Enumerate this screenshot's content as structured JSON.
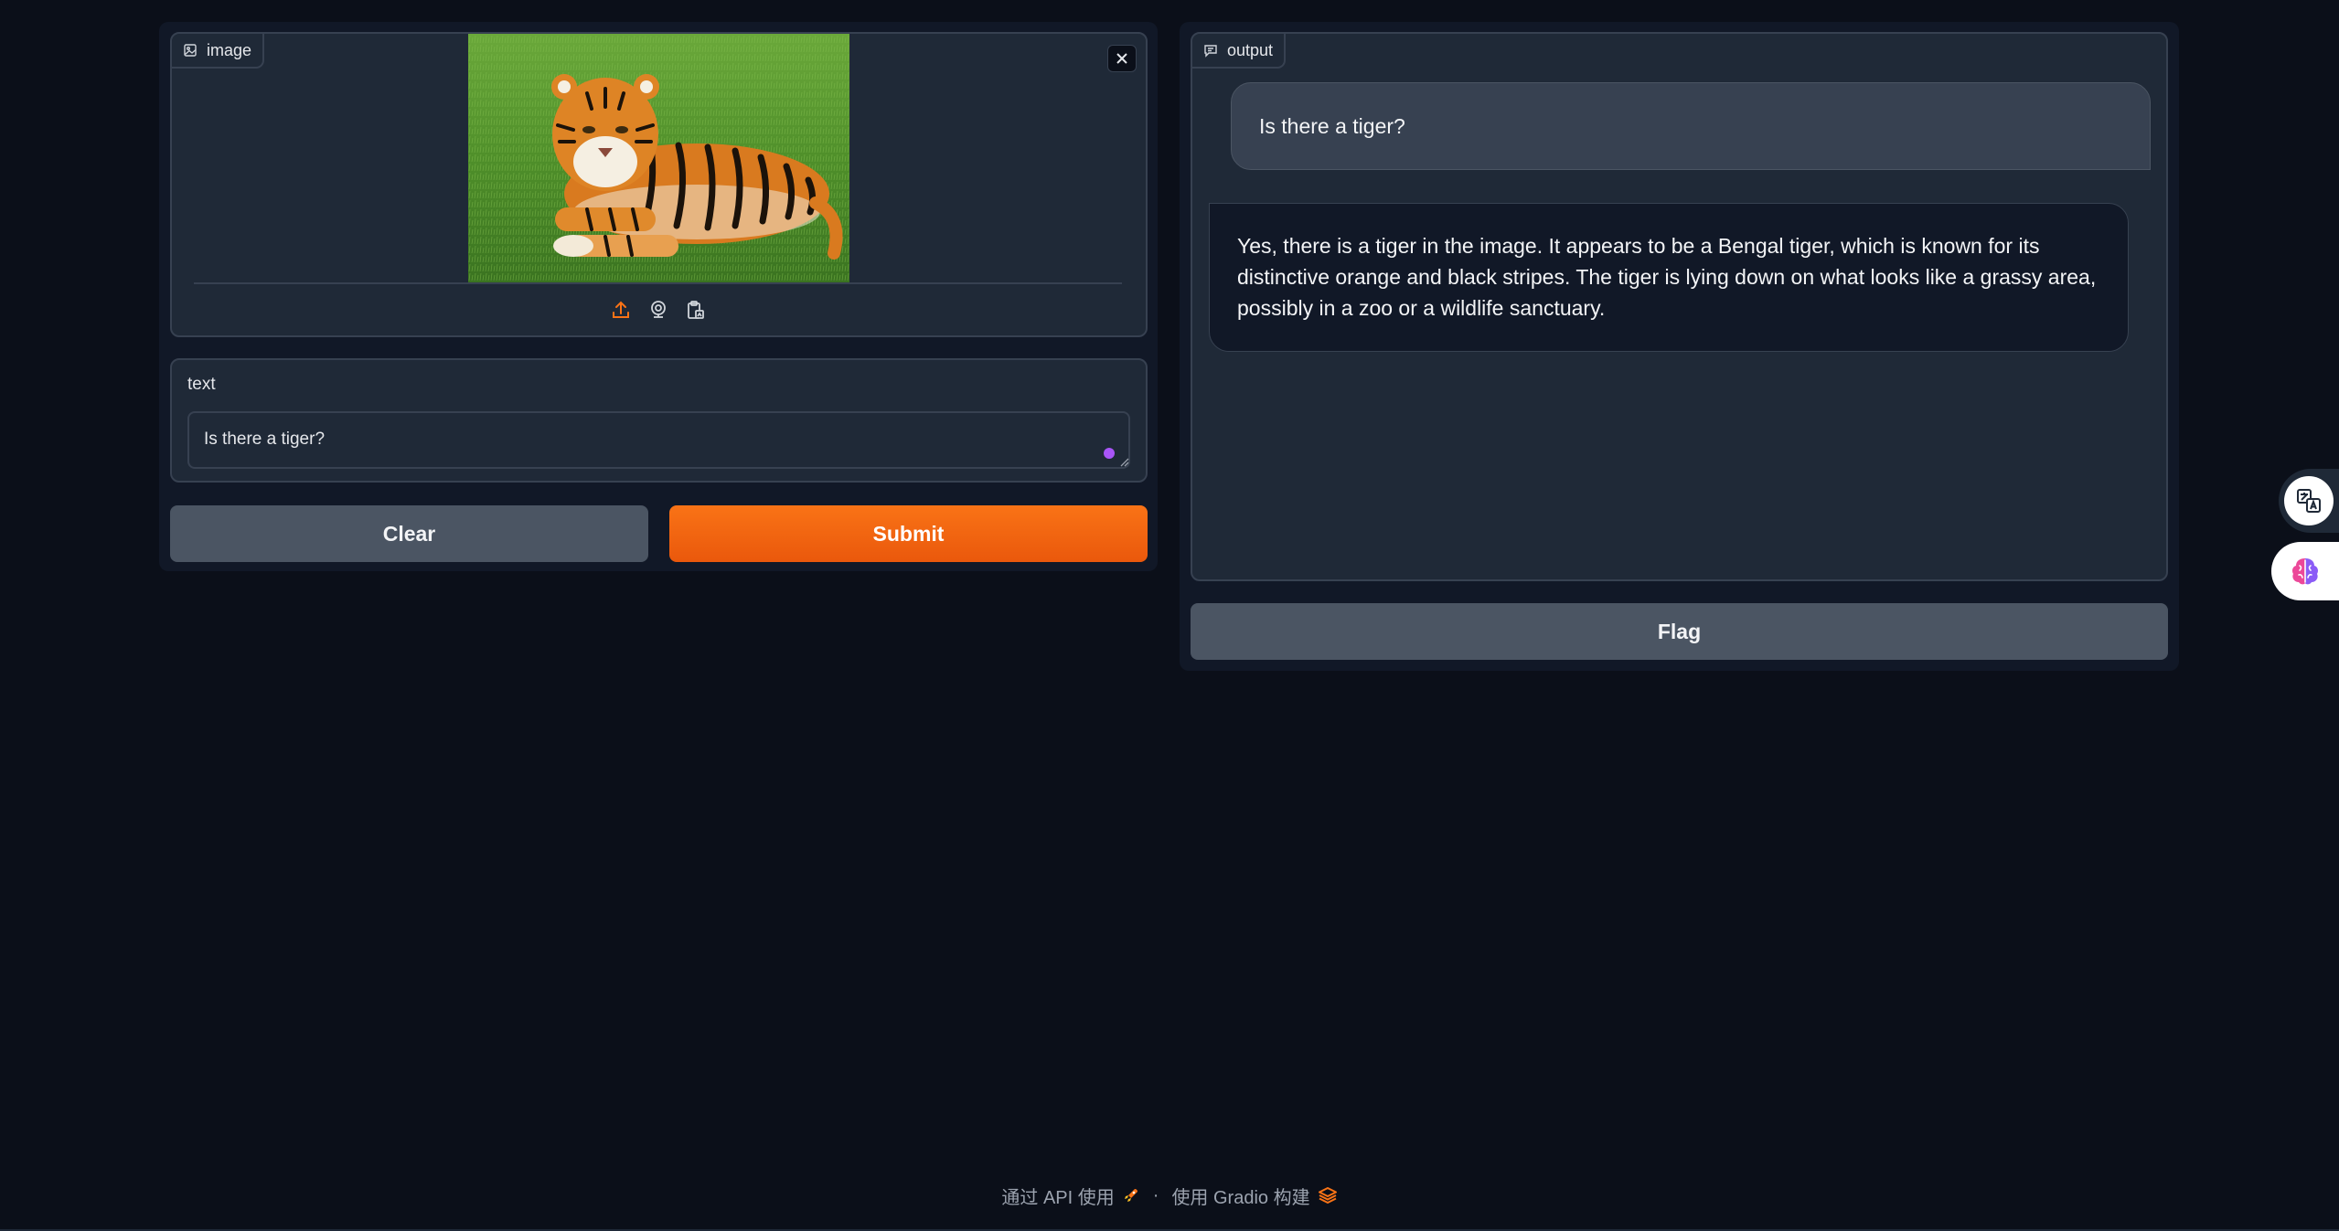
{
  "input_panel": {
    "image": {
      "label": "image",
      "label_icon": "image-icon",
      "toolbar_icons": [
        "upload-icon",
        "webcam-icon",
        "clipboard-icon"
      ]
    },
    "text": {
      "label": "text",
      "value": "Is there a tiger?"
    },
    "buttons": {
      "clear": "Clear",
      "submit": "Submit"
    }
  },
  "output_panel": {
    "label": "output",
    "label_icon": "chat-icon",
    "messages": [
      {
        "role": "user",
        "text": "Is there a tiger?"
      },
      {
        "role": "bot",
        "text": "Yes, there is a tiger in the image. It appears to be a Bengal tiger, which is known for its distinctive orange and black stripes. The tiger is lying down on what looks like a grassy area, possibly in a zoo or a wildlife sanctuary."
      }
    ],
    "flag_label": "Flag"
  },
  "footer": {
    "api_link": "通过 API 使用",
    "separator": "·",
    "built_with": "使用 Gradio 构建"
  },
  "colors": {
    "background": "#0b0f19",
    "accent": "#f97316",
    "status_dot": "#a855f7"
  }
}
